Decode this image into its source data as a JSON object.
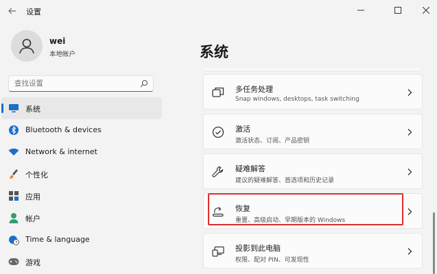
{
  "window": {
    "title": "设置"
  },
  "profile": {
    "name": "wei",
    "subtitle": "本地帐户"
  },
  "search": {
    "placeholder": "查找设置"
  },
  "sidebar": {
    "items": [
      {
        "label": "系统",
        "icon": "monitor-icon",
        "active": true
      },
      {
        "label": "Bluetooth & devices",
        "icon": "bluetooth-icon"
      },
      {
        "label": "Network & internet",
        "icon": "wifi-icon"
      },
      {
        "label": "个性化",
        "icon": "brush-icon"
      },
      {
        "label": "应用",
        "icon": "apps-icon"
      },
      {
        "label": "帐户",
        "icon": "person-icon"
      },
      {
        "label": "Time & language",
        "icon": "globe-clock-icon"
      },
      {
        "label": "游戏",
        "icon": "gamepad-icon"
      }
    ]
  },
  "main": {
    "title": "系统",
    "cards": [
      {
        "title": "多任务处理",
        "subtitle": "Snap windows, desktops, task switching",
        "icon": "multitask-icon"
      },
      {
        "title": "激活",
        "subtitle": "激活状态、订阅、产品密钥",
        "icon": "check-circle-icon"
      },
      {
        "title": "疑难解答",
        "subtitle": "建议的疑难解答、首选项和历史记录",
        "icon": "wrench-icon"
      },
      {
        "title": "恢复",
        "subtitle": "重置、高级启动、早期版本的 Windows",
        "icon": "recovery-icon"
      },
      {
        "title": "投影到此电脑",
        "subtitle": "权限、配对 PIN、可发现性",
        "icon": "project-icon"
      }
    ]
  },
  "colors": {
    "accent": "#1a6fc9",
    "highlight": "#e02b2b",
    "background": "#f3f3f3"
  }
}
